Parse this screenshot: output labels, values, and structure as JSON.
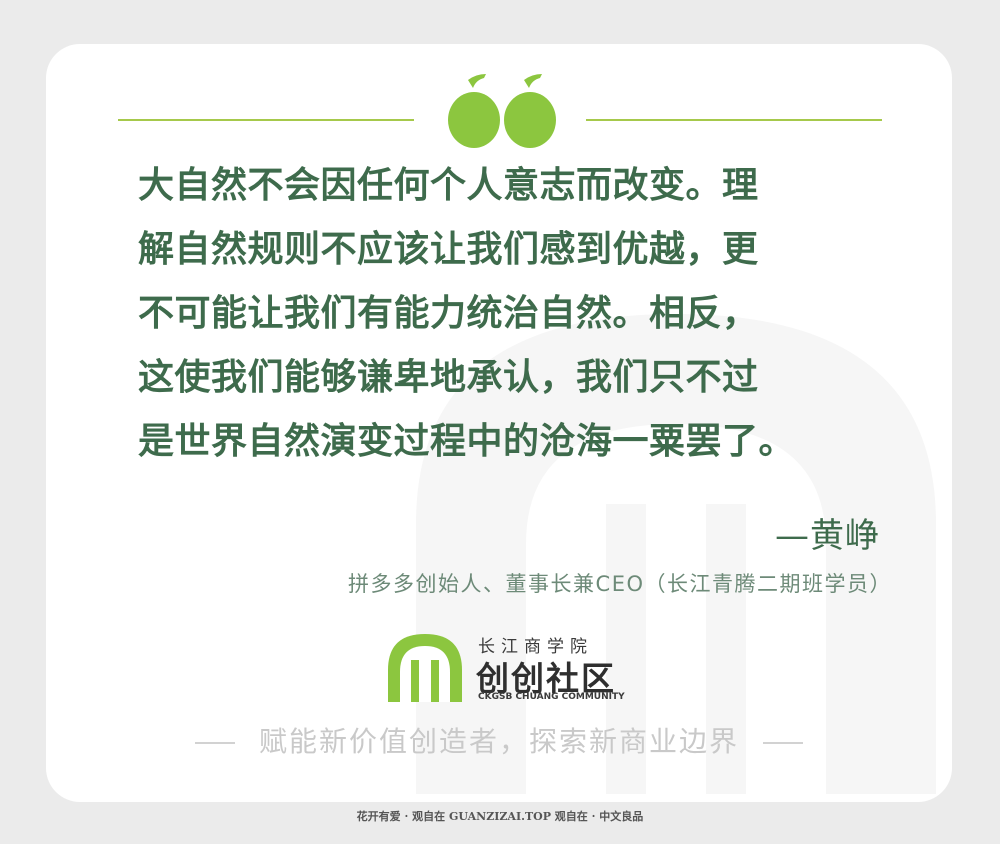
{
  "quote": {
    "lines": [
      "大自然不会因任何个人意志而改变。理",
      "解自然规则不应该让我们感到优越，更",
      "不可能让我们有能力统治自然。相反，",
      "这使我们能够谦卑地承认，我们只不过",
      "是世界自然演变过程中的沧海一粟罢了。"
    ],
    "author": "—黄峥",
    "author_title": "拼多多创始人、董事长兼CEO（长江青腾二期班学员）"
  },
  "logo": {
    "top_text": "长江商学院",
    "main_text": "创创社区",
    "english_text": "CKGSB CHUANG COMMUNITY"
  },
  "slogan": "赋能新价值创造者，探索新商业边界",
  "footer": "花开有爱 · 观自在  GUANZIZAI.TOP  观自在 · 中文良品",
  "colors": {
    "accent_green": "#8cc63f",
    "text_green": "#3e6b4c",
    "card_bg": "#ffffff",
    "page_bg": "#ebebeb"
  },
  "icons": [
    "quote-mark-icon",
    "ckgsb-logo-icon",
    "watermark-arch-icon"
  ]
}
